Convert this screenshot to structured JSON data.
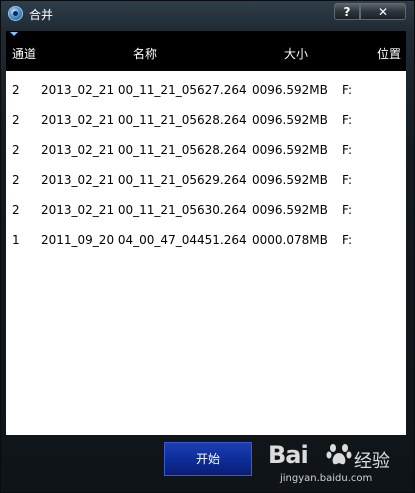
{
  "window": {
    "title": "合并",
    "help_label": "?",
    "close_label": "✕"
  },
  "table": {
    "columns": [
      "通道",
      "名称",
      "大小",
      "位置"
    ],
    "rows": [
      {
        "channel": "2",
        "name": "2013_02_21 00_11_21_05627.264",
        "size": "0096.592MB",
        "location": "F:"
      },
      {
        "channel": "2",
        "name": "2013_02_21 00_11_21_05628.264",
        "size": "0096.592MB",
        "location": "F:"
      },
      {
        "channel": "2",
        "name": "2013_02_21 00_11_21_05628.264",
        "size": "0096.592MB",
        "location": "F:"
      },
      {
        "channel": "2",
        "name": "2013_02_21 00_11_21_05629.264",
        "size": "0096.592MB",
        "location": "F:"
      },
      {
        "channel": "2",
        "name": "2013_02_21 00_11_21_05630.264",
        "size": "0096.592MB",
        "location": "F:"
      },
      {
        "channel": "1",
        "name": "2011_09_20 04_00_47_04451.264",
        "size": "0000.078MB",
        "location": "F:"
      }
    ]
  },
  "footer": {
    "start_label": "开始"
  },
  "watermark": {
    "logo": "Bai",
    "logo_suffix": "经验",
    "url": "jingyan.baidu.com"
  },
  "colors": {
    "accent": "#0e2d9a",
    "header_bg": "#000000",
    "frame": "#141b21"
  }
}
